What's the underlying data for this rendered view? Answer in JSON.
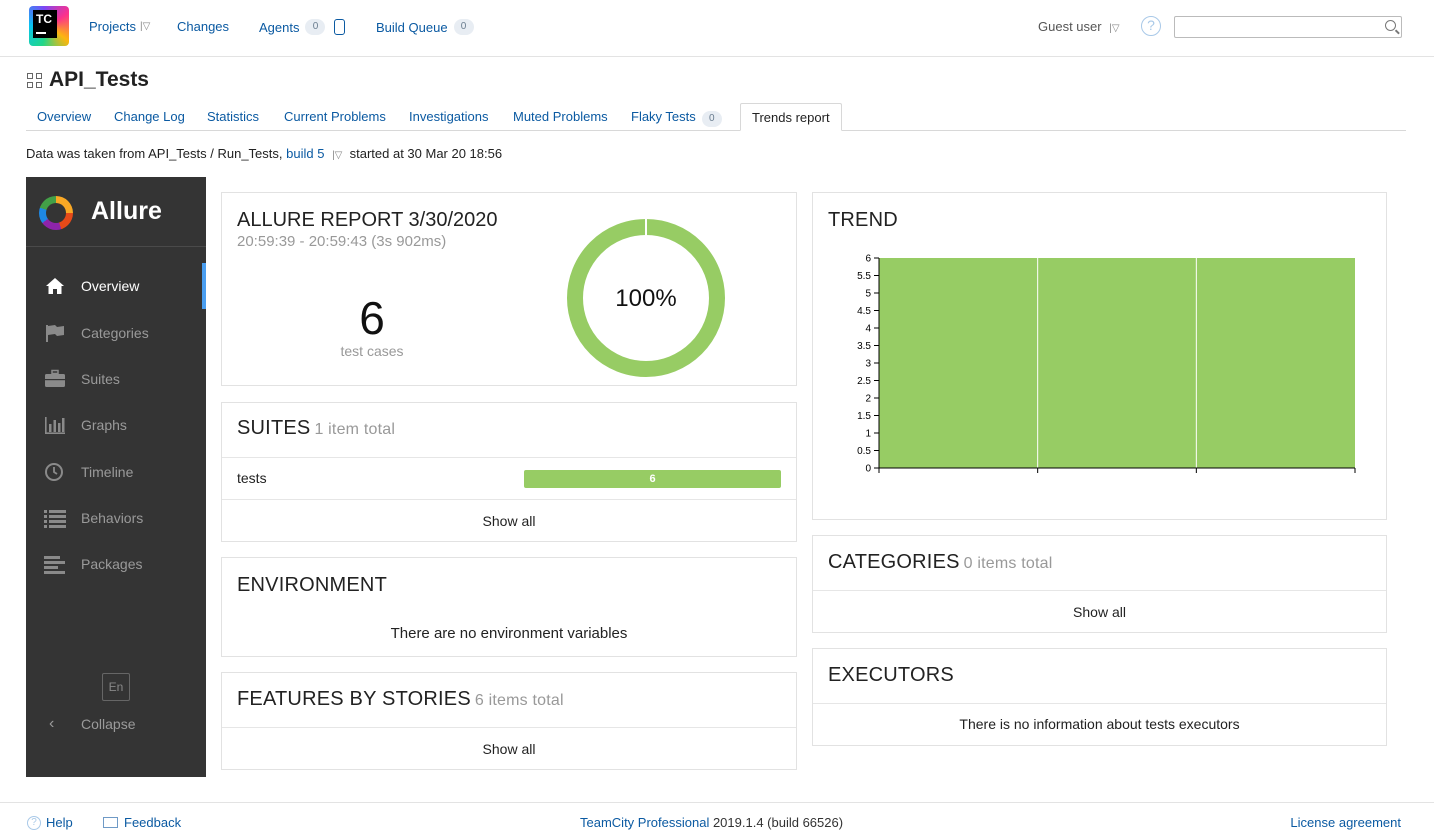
{
  "topbar": {
    "nav": [
      {
        "label": "Projects",
        "has_menu": true
      },
      {
        "label": "Changes"
      },
      {
        "label": "Agents",
        "count": "0"
      },
      {
        "label": "Build Queue",
        "count": "0"
      }
    ],
    "user": "Guest user",
    "search_placeholder": ""
  },
  "header": {
    "title": "API_Tests",
    "tabs": [
      {
        "label": "Overview"
      },
      {
        "label": "Change Log"
      },
      {
        "label": "Statistics"
      },
      {
        "label": "Current Problems"
      },
      {
        "label": "Investigations"
      },
      {
        "label": "Muted Problems"
      },
      {
        "label": "Flaky Tests",
        "count": "0"
      },
      {
        "label": "Trends report",
        "active": true
      }
    ],
    "data_info": {
      "prefix": "Data was taken from API_Tests / Run_Tests,",
      "build_link": "build 5",
      "suffix": "started at 30 Mar 20 18:56"
    }
  },
  "allure": {
    "brand": "Allure",
    "menu": [
      {
        "label": "Overview",
        "icon": "home-icon",
        "active": true
      },
      {
        "label": "Categories",
        "icon": "flag-icon"
      },
      {
        "label": "Suites",
        "icon": "briefcase-icon"
      },
      {
        "label": "Graphs",
        "icon": "bar-chart-icon"
      },
      {
        "label": "Timeline",
        "icon": "clock-icon"
      },
      {
        "label": "Behaviors",
        "icon": "list-icon"
      },
      {
        "label": "Packages",
        "icon": "align-left-icon"
      }
    ],
    "language": "En",
    "collapse_label": "Collapse",
    "report": {
      "title": "ALLURE REPORT 3/30/2020",
      "time_range": "20:59:39 - 20:59:43 (3s 902ms)",
      "test_count": "6",
      "test_count_label": "test cases",
      "pass_percent_label": "100%",
      "pass_fraction": 1.0
    },
    "suites": {
      "title": "SUITES",
      "subtitle": "1 item total",
      "rows": [
        {
          "name": "tests",
          "passed": "6"
        }
      ],
      "show_all": "Show all"
    },
    "environment": {
      "title": "ENVIRONMENT",
      "message": "There are no environment variables"
    },
    "features": {
      "title": "FEATURES BY STORIES",
      "subtitle": "6 items total",
      "show_all": "Show all"
    },
    "trend": {
      "title": "TREND"
    },
    "categories": {
      "title": "CATEGORIES",
      "subtitle": "0 items total",
      "show_all": "Show all"
    },
    "executors": {
      "title": "EXECUTORS",
      "message": "There is no information about tests executors"
    }
  },
  "colors": {
    "passed": "#97cc64",
    "sidebar_bg": "#343434",
    "link": "#0b5aa2"
  },
  "chart_data": {
    "type": "area",
    "x": [
      1,
      2,
      3,
      4
    ],
    "series": [
      {
        "values": [
          6,
          6,
          6,
          6
        ]
      }
    ],
    "ylim": [
      0,
      6
    ],
    "y_ticks": [
      "0",
      "0.5",
      "1",
      "1.5",
      "2",
      "2.5",
      "3",
      "3.5",
      "4",
      "4.5",
      "5",
      "5.5",
      "6"
    ],
    "title": "",
    "xlabel": "",
    "ylabel": ""
  },
  "footer": {
    "help": "Help",
    "feedback": "Feedback",
    "product": "TeamCity Professional",
    "version": "2019.1.4 (build 66526)",
    "license": "License agreement"
  }
}
